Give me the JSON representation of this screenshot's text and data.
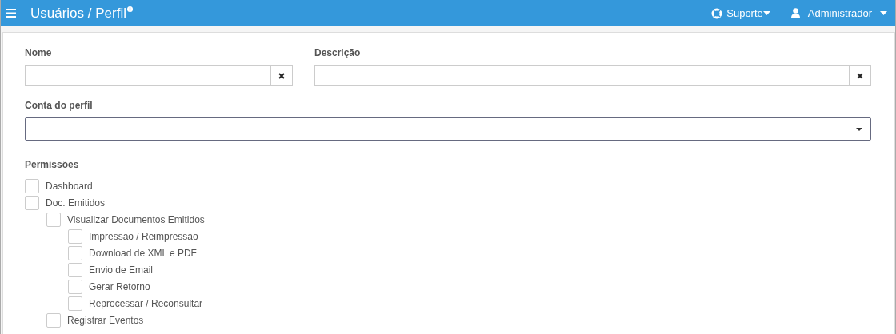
{
  "header": {
    "title": "Usuários / Perfil",
    "support": "Suporte",
    "user": "Administrador"
  },
  "fields": [
    {
      "label": "Nome"
    },
    {
      "label": "Descrição"
    }
  ],
  "select": {
    "label": "Conta do perfil",
    "focused": true
  },
  "permissions": {
    "label": "Permissões",
    "items": [
      {
        "label": "Dashboard",
        "checked": false
      },
      {
        "label": "Doc. Emitidos",
        "checked": false,
        "children": [
          {
            "label": "Visualizar Documentos Emitidos",
            "checked": false,
            "children": [
              {
                "label": "Impressão / Reimpressão",
                "checked": false
              },
              {
                "label": "Download de XML e PDF",
                "checked": false
              },
              {
                "label": "Envio de Email",
                "checked": false
              },
              {
                "label": "Gerar Retorno",
                "checked": false
              },
              {
                "label": "Reprocessar / Reconsultar",
                "checked": false
              }
            ]
          },
          {
            "label": "Registrar Eventos",
            "checked": false
          }
        ]
      }
    ]
  }
}
